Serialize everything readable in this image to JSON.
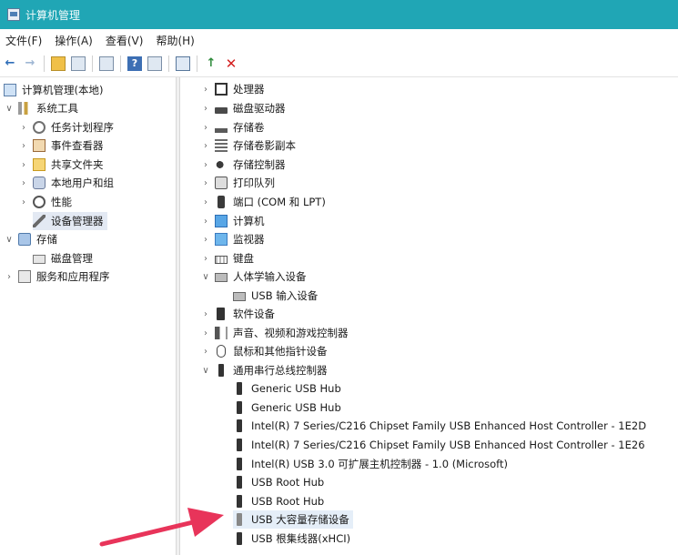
{
  "window": {
    "title": "计算机管理"
  },
  "menu": [
    "文件(F)",
    "操作(A)",
    "查看(V)",
    "帮助(H)"
  ],
  "left_tree": [
    {
      "label": "计算机管理(本地)",
      "icon": "computer-management-icon",
      "chevron": ""
    },
    {
      "label": "系统工具",
      "icon": "tools-icon",
      "chevron": "expanded"
    },
    {
      "label": "任务计划程序",
      "icon": "task-scheduler-icon",
      "chevron": "collapsed"
    },
    {
      "label": "事件查看器",
      "icon": "event-viewer-icon",
      "chevron": "collapsed"
    },
    {
      "label": "共享文件夹",
      "icon": "shared-folder-icon",
      "chevron": "collapsed"
    },
    {
      "label": "本地用户和组",
      "icon": "users-icon",
      "chevron": "collapsed"
    },
    {
      "label": "性能",
      "icon": "performance-icon",
      "chevron": "collapsed"
    },
    {
      "label": "设备管理器",
      "icon": "device-manager-icon",
      "chevron": "",
      "selected": true
    },
    {
      "label": "存储",
      "icon": "storage-icon",
      "chevron": "expanded"
    },
    {
      "label": "磁盘管理",
      "icon": "disk-management-icon",
      "chevron": ""
    },
    {
      "label": "服务和应用程序",
      "icon": "services-icon",
      "chevron": "collapsed"
    }
  ],
  "device_tree": [
    {
      "label": "处理器",
      "icon": "processor-icon",
      "chevron": "collapsed"
    },
    {
      "label": "磁盘驱动器",
      "icon": "disk-drive-icon",
      "chevron": "collapsed"
    },
    {
      "label": "存储卷",
      "icon": "storage-volume-icon",
      "chevron": "collapsed"
    },
    {
      "label": "存储卷影副本",
      "icon": "volume-shadow-icon",
      "chevron": "collapsed"
    },
    {
      "label": "存储控制器",
      "icon": "storage-controller-icon",
      "chevron": "collapsed"
    },
    {
      "label": "打印队列",
      "icon": "printer-icon",
      "chevron": "collapsed"
    },
    {
      "label": "端口 (COM 和 LPT)",
      "icon": "port-icon",
      "chevron": "collapsed"
    },
    {
      "label": "计算机",
      "icon": "computer-icon",
      "chevron": "collapsed"
    },
    {
      "label": "监视器",
      "icon": "monitor-icon",
      "chevron": "collapsed"
    },
    {
      "label": "键盘",
      "icon": "keyboard-icon",
      "chevron": "collapsed"
    },
    {
      "label": "人体学输入设备",
      "icon": "hid-icon",
      "chevron": "expanded"
    },
    {
      "label": "USB 输入设备",
      "icon": "hid-device-icon",
      "chevron": "",
      "child": true
    },
    {
      "label": "软件设备",
      "icon": "software-device-icon",
      "chevron": "collapsed"
    },
    {
      "label": "声音、视频和游戏控制器",
      "icon": "sound-icon",
      "chevron": "collapsed"
    },
    {
      "label": "鼠标和其他指针设备",
      "icon": "mouse-icon",
      "chevron": "collapsed"
    },
    {
      "label": "通用串行总线控制器",
      "icon": "usb-controller-icon",
      "chevron": "expanded"
    },
    {
      "label": "Generic USB Hub",
      "icon": "usb-icon",
      "chevron": "",
      "child": true
    },
    {
      "label": "Generic USB Hub",
      "icon": "usb-icon",
      "chevron": "",
      "child": true
    },
    {
      "label": "Intel(R) 7 Series/C216 Chipset Family USB Enhanced Host Controller - 1E2D",
      "icon": "usb-icon",
      "chevron": "",
      "child": true
    },
    {
      "label": "Intel(R) 7 Series/C216 Chipset Family USB Enhanced Host Controller - 1E26",
      "icon": "usb-icon",
      "chevron": "",
      "child": true
    },
    {
      "label": "Intel(R) USB 3.0 可扩展主机控制器 - 1.0 (Microsoft)",
      "icon": "usb-icon",
      "chevron": "",
      "child": true
    },
    {
      "label": "USB Root Hub",
      "icon": "usb-icon",
      "chevron": "",
      "child": true
    },
    {
      "label": "USB Root Hub",
      "icon": "usb-icon",
      "chevron": "",
      "child": true
    },
    {
      "label": "USB 大容量存储设备",
      "icon": "usb-storage-icon",
      "chevron": "",
      "child": true,
      "highlighted": true
    },
    {
      "label": "USB 根集线器(xHCI)",
      "icon": "usb-icon",
      "chevron": "",
      "child": true
    }
  ],
  "annotation": {
    "type": "arrow",
    "color": "#e8345a",
    "points_to": "USB 大容量存储设备"
  }
}
